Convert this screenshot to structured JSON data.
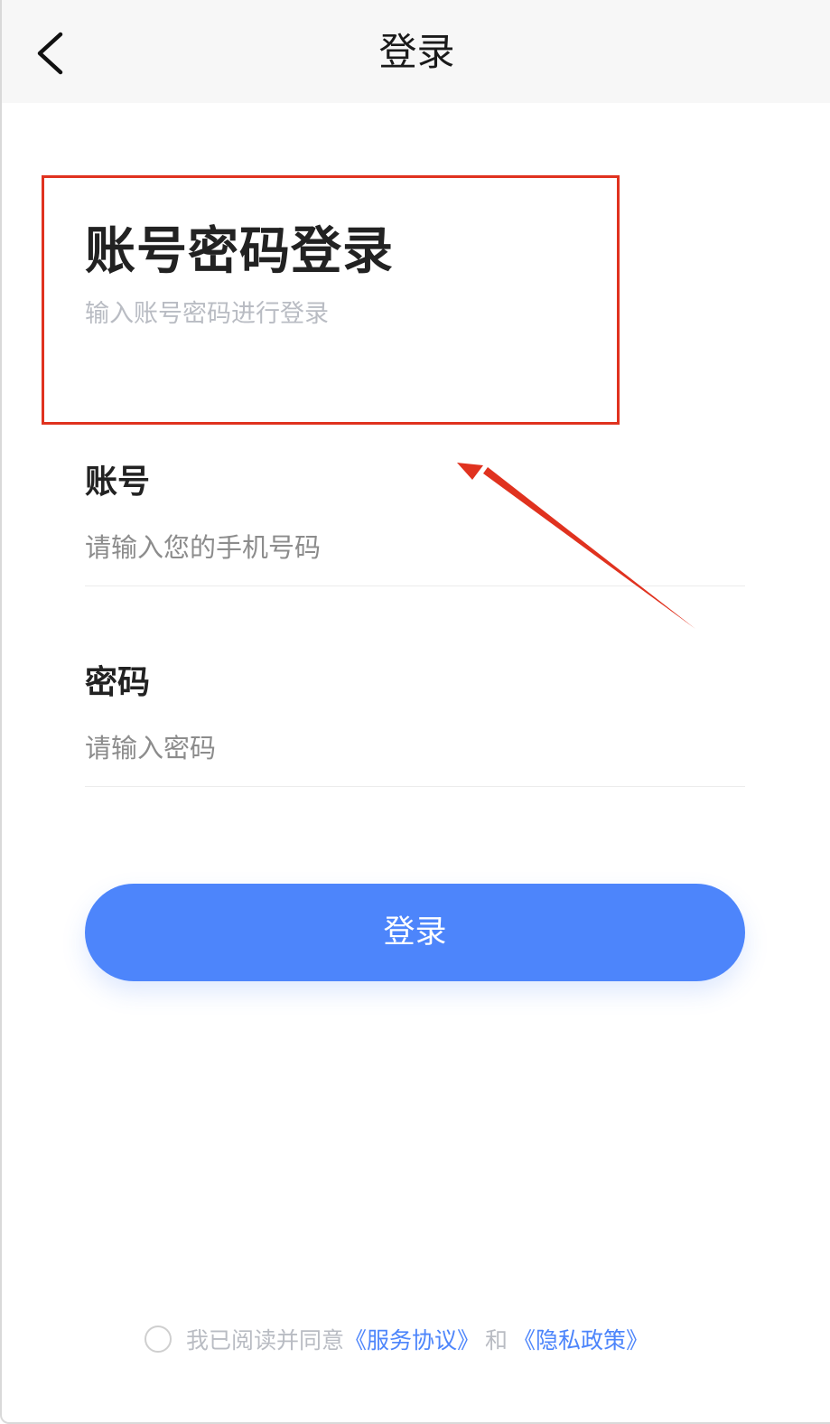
{
  "navbar": {
    "title": "登录",
    "back_icon": "chevron-left-icon"
  },
  "header": {
    "title": "账号密码登录",
    "subtitle": "输入账号密码进行登录"
  },
  "form": {
    "account": {
      "label": "账号",
      "placeholder": "请输入您的手机号码",
      "value": ""
    },
    "password": {
      "label": "密码",
      "placeholder": "请输入密码",
      "value": ""
    },
    "submit_label": "登录"
  },
  "agreement": {
    "text": "我已阅读并同意",
    "service_link": "《服务协议》",
    "conjunction": "和",
    "privacy_link": "《隐私政策》",
    "checked": false
  },
  "colors": {
    "primary": "#4d85fb",
    "annotation": "#e0321f",
    "navbar_bg": "#f7f7f7",
    "placeholder": "#8c8c8c",
    "muted_text": "#b9bcc3"
  }
}
